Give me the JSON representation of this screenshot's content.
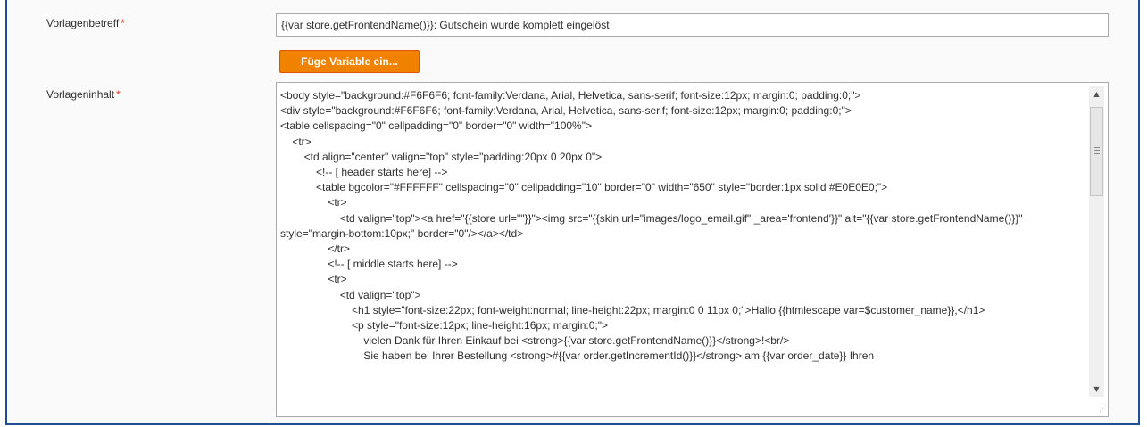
{
  "form": {
    "subject": {
      "label": "Vorlagenbetreff",
      "required_marker": "*",
      "value": "{{var store.getFrontendName()}}: Gutschein wurde komplett eingelöst"
    },
    "insert_variable_button": "Füge Variable ein...",
    "content": {
      "label": "Vorlageninhalt",
      "required_marker": "*",
      "value": "<body style=\"background:#F6F6F6; font-family:Verdana, Arial, Helvetica, sans-serif; font-size:12px; margin:0; padding:0;\">\n<div style=\"background:#F6F6F6; font-family:Verdana, Arial, Helvetica, sans-serif; font-size:12px; margin:0; padding:0;\">\n<table cellspacing=\"0\" cellpadding=\"0\" border=\"0\" width=\"100%\">\n    <tr>\n        <td align=\"center\" valign=\"top\" style=\"padding:20px 0 20px 0\">\n            <!-- [ header starts here] -->\n            <table bgcolor=\"#FFFFFF\" cellspacing=\"0\" cellpadding=\"10\" border=\"0\" width=\"650\" style=\"border:1px solid #E0E0E0;\">\n                <tr>\n                    <td valign=\"top\"><a href=\"{{store url=\"\"}}\"><img src=\"{{skin url=\"images/logo_email.gif\" _area='frontend'}}\" alt=\"{{var store.getFrontendName()}}\"  style=\"margin-bottom:10px;\" border=\"0\"/></a></td>\n                </tr>\n                <!-- [ middle starts here] -->\n                <tr>\n                    <td valign=\"top\">\n                        <h1 style=\"font-size:22px; font-weight:normal; line-height:22px; margin:0 0 11px 0;\">Hallo {{htmlescape var=$customer_name}},</h1>\n                        <p style=\"font-size:12px; line-height:16px; margin:0;\">\n                            vielen Dank für Ihren Einkauf bei <strong>{{var store.getFrontendName()}}</strong>!<br/>\n                            Sie haben bei Ihrer Bestellung <strong>#{{var order.getIncrementId()}}</strong> am {{var order_date}} Ihren"
    }
  },
  "colors": {
    "frame_border": "#1f4e96",
    "button_bg": "#f18200",
    "required": "#eb340a"
  },
  "icons": {
    "scroll_up": "▲",
    "scroll_down": "▼",
    "resize": "⋰"
  }
}
